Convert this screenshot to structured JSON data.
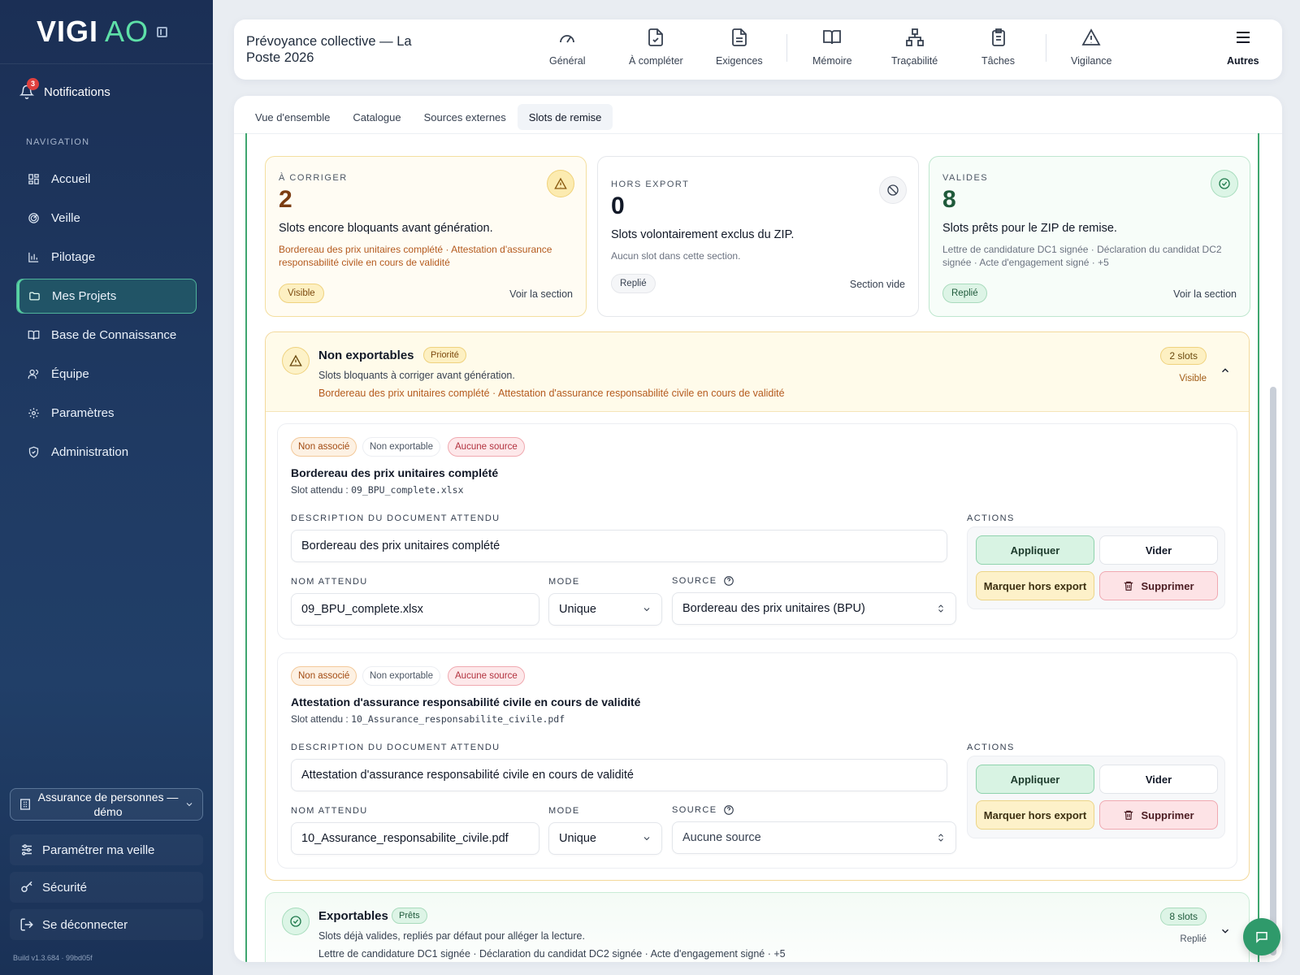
{
  "brand": {
    "main": "VIGI",
    "sub": "AO"
  },
  "sidebar": {
    "notifications": {
      "label": "Notifications",
      "count": "3"
    },
    "section_label": "NAVIGATION",
    "items": [
      {
        "label": "Accueil",
        "icon": "grid-icon"
      },
      {
        "label": "Veille",
        "icon": "radar-icon"
      },
      {
        "label": "Pilotage",
        "icon": "bar-chart-icon"
      },
      {
        "label": "Mes Projets",
        "icon": "folder-icon",
        "active": true
      },
      {
        "label": "Base de Connaissance",
        "icon": "book-icon"
      },
      {
        "label": "Équipe",
        "icon": "users-icon"
      },
      {
        "label": "Paramètres",
        "icon": "gear-icon"
      },
      {
        "label": "Administration",
        "icon": "shield-icon"
      }
    ],
    "org": "Assurance de personnes — démo",
    "configure": "Paramétrer ma veille",
    "security": "Sécurité",
    "logout": "Se déconnecter",
    "build": "Build v1.3.684 · 99bd05f"
  },
  "header": {
    "title": "Prévoyance collective — La Poste 2026",
    "nav": [
      {
        "label": "Général",
        "icon": "gauge-icon"
      },
      {
        "label": "À compléter",
        "icon": "file-check-icon"
      },
      {
        "label": "Exigences",
        "icon": "document-icon"
      },
      {
        "label": "Mémoire",
        "icon": "open-book-icon"
      },
      {
        "label": "Traçabilité",
        "icon": "hierarchy-icon"
      },
      {
        "label": "Tâches",
        "icon": "clipboard-icon"
      },
      {
        "label": "Vigilance",
        "icon": "warning-icon"
      },
      {
        "label": "Autres",
        "icon": "menu-icon"
      }
    ]
  },
  "tabs": [
    "Vue d'ensemble",
    "Catalogue",
    "Sources externes",
    "Slots de remise"
  ],
  "stats": {
    "correct": {
      "caption": "À CORRIGER",
      "count": "2",
      "desc": "Slots encore bloquants avant génération.",
      "sub": "Bordereau des prix unitaires complété · Attestation d'assurance responsabilité civile en cours de validité",
      "pill": "Visible",
      "link": "Voir la section"
    },
    "excluded": {
      "caption": "HORS EXPORT",
      "count": "0",
      "desc": "Slots volontairement exclus du ZIP.",
      "sub": "Aucun slot dans cette section.",
      "pill": "Replié",
      "link": "Section vide"
    },
    "valid": {
      "caption": "VALIDES",
      "count": "8",
      "desc": "Slots prêts pour le ZIP de remise.",
      "sub": "Lettre de candidature DC1 signée · Déclaration du candidat DC2 signée · Acte d'engagement signé · +5",
      "pill": "Replié",
      "link": "Voir la section"
    }
  },
  "non_exportable": {
    "title": "Non exportables",
    "badge": "Priorité",
    "line1": "Slots bloquants à corriger avant génération.",
    "line2": "Bordereau des prix unitaires complété · Attestation d'assurance responsabilité civile en cours de validité",
    "count": "2 slots",
    "state": "Visible"
  },
  "slot_labels": {
    "chip_unlinked": "Non associé",
    "chip_nonexport": "Non exportable",
    "chip_nosource": "Aucune source",
    "expected_prefix": "Slot attendu :",
    "desc_label": "DESCRIPTION DU DOCUMENT ATTENDU",
    "name_label": "NOM ATTENDU",
    "mode_label": "MODE",
    "source_label": "SOURCE",
    "actions_label": "ACTIONS",
    "apply": "Appliquer",
    "clear": "Vider",
    "mark_excluded": "Marquer hors export",
    "delete": "Supprimer"
  },
  "slots": [
    {
      "title": "Bordereau des prix unitaires complété",
      "file": "09_BPU_complete.xlsx",
      "description": "Bordereau des prix unitaires complété",
      "name": "09_BPU_complete.xlsx",
      "mode": "Unique",
      "source": "Bordereau des prix unitaires (BPU)"
    },
    {
      "title": "Attestation d'assurance responsabilité civile en cours de validité",
      "file": "10_Assurance_responsabilite_civile.pdf",
      "description": "Attestation d'assurance responsabilité civile en cours de validité",
      "name": "10_Assurance_responsabilite_civile.pdf",
      "mode": "Unique",
      "source": "Aucune source"
    }
  ],
  "exportable": {
    "title": "Exportables",
    "badge": "Prêts",
    "line1": "Slots déjà valides, repliés par défaut pour alléger la lecture.",
    "line2": "Lettre de candidature DC1 signée · Déclaration du candidat DC2 signée · Acte d'engagement signé · +5",
    "count": "8 slots",
    "state": "Replié"
  },
  "colors": {
    "accent_green": "#3fa66f",
    "warning": "#f3d99b",
    "danger": "#e0403e",
    "sidebar_bg": "#1f3a63"
  }
}
